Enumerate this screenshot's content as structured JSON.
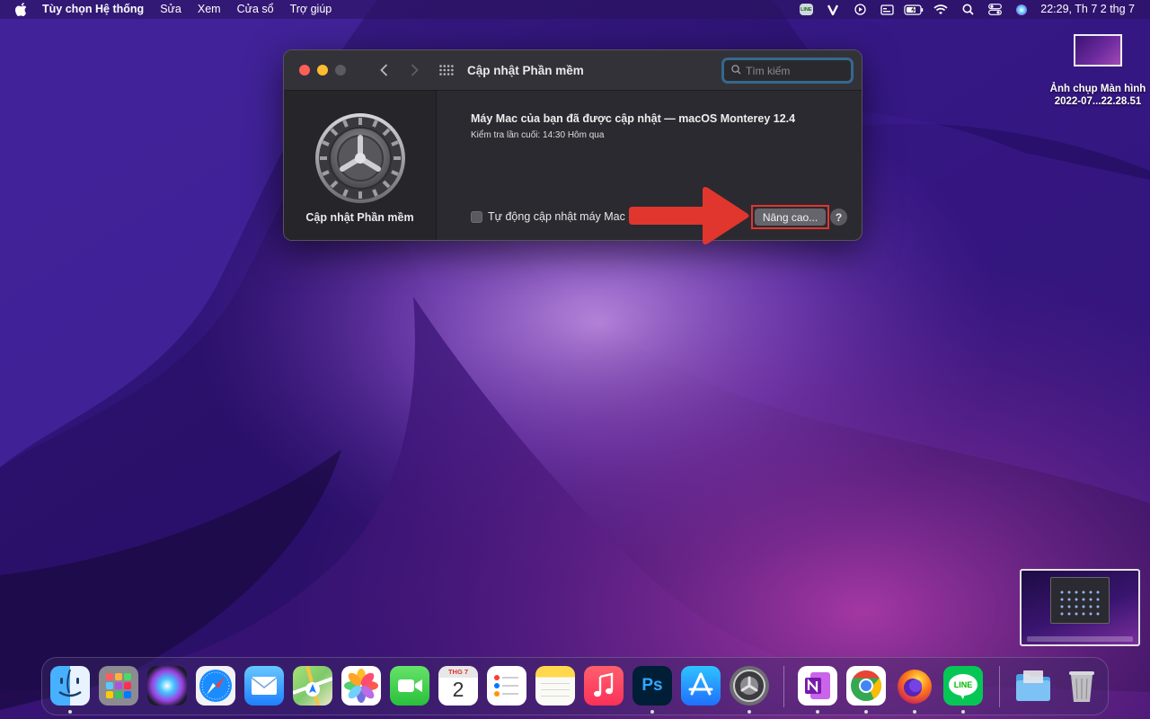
{
  "menubar": {
    "app_name": "Tùy chọn Hệ thống",
    "items": [
      "Sửa",
      "Xem",
      "Cửa sổ",
      "Trợ giúp"
    ],
    "status_icons": [
      "line-icon",
      "v-icon",
      "play-icon",
      "screen-icon",
      "battery-charging-icon",
      "wifi-icon",
      "search-icon",
      "control-center-icon",
      "siri-icon"
    ],
    "line_badge": "LINE",
    "clock": "22:29, Th 7 2 thg 7"
  },
  "desktop": {
    "file_name_line1": "Ảnh chụp Màn hình",
    "file_name_line2": "2022-07...22.28.51"
  },
  "window": {
    "title": "Cập nhật Phần mềm",
    "search_placeholder": "Tìm kiếm",
    "sidebar_label": "Cập nhật Phần mềm",
    "status_title": "Máy Mac của bạn đã được cập nhật — macOS Monterey 12.4",
    "status_sub": "Kiểm tra lần cuối: 14:30 Hôm qua",
    "auto_update_label": "Tự động cập nhật máy Mac của",
    "auto_update_checked": false,
    "advanced_button": "Nâng cao...",
    "help_button": "?"
  },
  "annotation": {
    "arrow_color": "#e0362e"
  },
  "dock": {
    "apps": [
      "Finder",
      "Launchpad",
      "Siri",
      "Safari",
      "Mail",
      "Maps",
      "Photos",
      "FaceTime",
      "Calendar",
      "Reminders",
      "Notes",
      "Music",
      "Photoshop",
      "App Store",
      "System Preferences",
      "OneNote",
      "Chrome",
      "Firefox",
      "LINE",
      "Downloads",
      "Trash"
    ],
    "calendar_month": "THG 7",
    "calendar_day": "2",
    "ps_label": "Ps",
    "line_label": "LINE"
  },
  "colors": {
    "accent_red": "#e0362e",
    "search_focus": "#35688f",
    "window_bg": "#2b2a30"
  }
}
